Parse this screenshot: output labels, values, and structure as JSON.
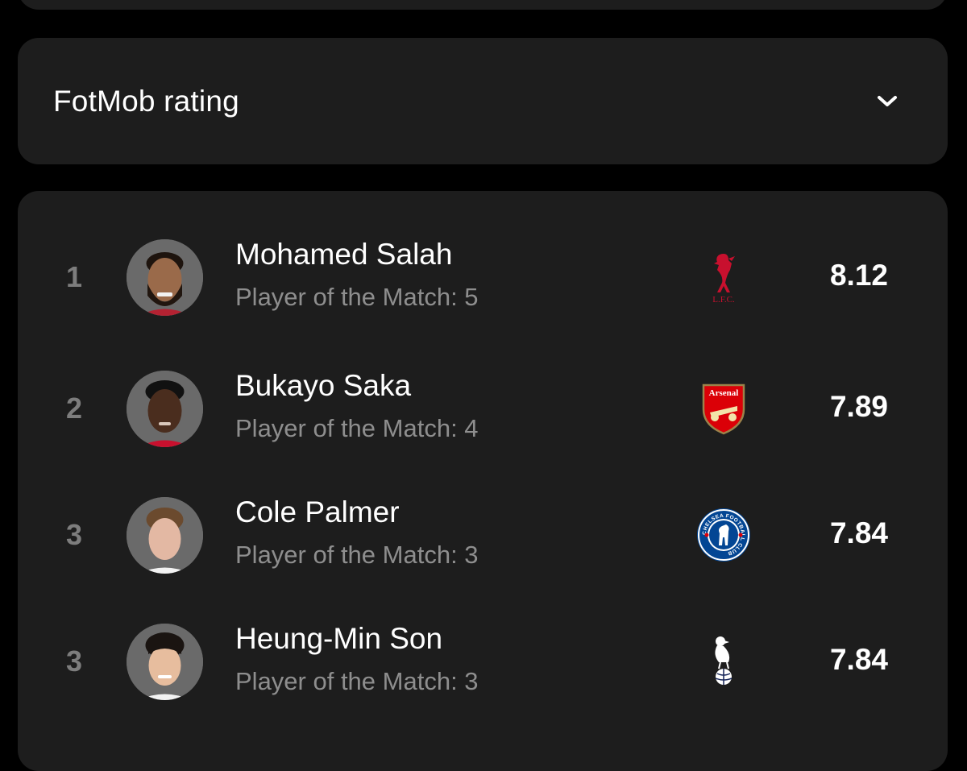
{
  "selector": {
    "title": "FotMob rating",
    "icon": "chevron-down-icon"
  },
  "players": [
    {
      "rank": "1",
      "name": "Mohamed Salah",
      "potm": "Player of the Match: 5",
      "rating": "8.12",
      "club_icon": "liverpool-crest-icon",
      "club_logo_text": "L.F.C."
    },
    {
      "rank": "2",
      "name": "Bukayo Saka",
      "potm": "Player of the Match: 4",
      "rating": "7.89",
      "club_icon": "arsenal-crest-icon",
      "club_logo_text": "Arsenal"
    },
    {
      "rank": "3",
      "name": "Cole Palmer",
      "potm": "Player of the Match: 3",
      "rating": "7.84",
      "club_icon": "chelsea-crest-icon",
      "club_logo_text": "CHELSEA FOOTBALL CLUB"
    },
    {
      "rank": "3",
      "name": "Heung-Min Son",
      "potm": "Player of the Match: 3",
      "rating": "7.84",
      "club_icon": "tottenham-crest-icon"
    }
  ],
  "colors": {
    "background": "#000000",
    "card": "#1d1d1d",
    "primary_text": "#ffffff",
    "secondary_text": "#8e8e8e",
    "rank_text": "#7d7d7d",
    "liverpool_red": "#c8102e",
    "arsenal_red": "#db0007",
    "chelsea_blue": "#034694",
    "tottenham_navy": "#132257"
  }
}
